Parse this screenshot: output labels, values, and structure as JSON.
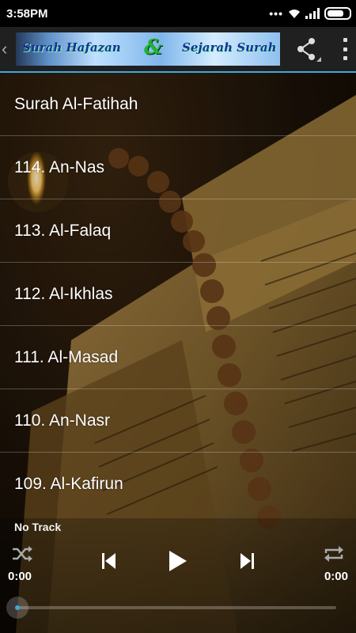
{
  "status_bar": {
    "time": "3:58PM",
    "dots": "•••"
  },
  "action_bar": {
    "banner_part1": "Surah Hafazan",
    "banner_amp": "&",
    "banner_part2": "Sejarah Surah"
  },
  "list": {
    "items": [
      "Surah Al-Fatihah",
      "114. An-Nas",
      "113. Al-Falaq",
      "112. Al-Ikhlas",
      "111. Al-Masad",
      "110. An-Nasr",
      "109. Al-Kafirun"
    ]
  },
  "player": {
    "track": "No Track",
    "elapsed": "0:00",
    "duration": "0:00",
    "progress": 0
  },
  "colors": {
    "accent": "#3fa8de",
    "action_bar": "#202020"
  }
}
